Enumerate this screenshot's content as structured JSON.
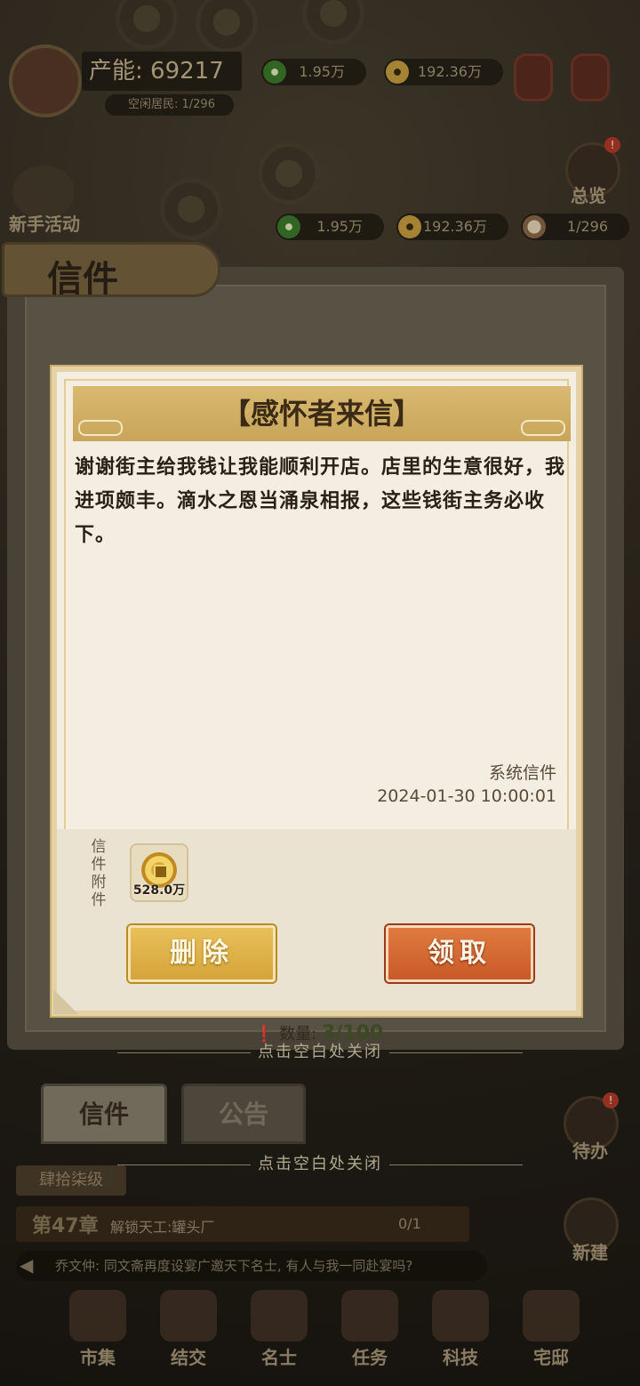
{
  "hud": {
    "production": "产能: 69217",
    "idle_residents": "空闲居民: 1/296",
    "res_green": "1.95万",
    "res_gold": "192.36万"
  },
  "side": {
    "overview_label": "总览",
    "newbie_label": "新手活动"
  },
  "resources": {
    "green": "1.95万",
    "gold": "192.36万",
    "residents": "1/296"
  },
  "mail_panel": {
    "title": "信件",
    "count_label": "数量:",
    "count_value": "3/100",
    "tabs": [
      "信件",
      "公告"
    ],
    "close_hint": "点击空白处关闭"
  },
  "bottom": {
    "todo_label": "待办",
    "build_label": "新建",
    "close_hint": "点击空白处关闭",
    "level_tag": "肆拾柒级",
    "chapter": "第47章",
    "chapter_goal": "解锁天工:罐头厂",
    "chapter_progress": "0/1",
    "chat": "乔文仲: 同文斋再度设宴广邀天下名士, 有人与我一同赴宴吗?",
    "nav": [
      "市集",
      "结交",
      "名士",
      "任务",
      "科技",
      "宅邸"
    ]
  },
  "letter": {
    "title": "【感怀者来信】",
    "body": "谢谢街主给我钱让我能顺利开店。店里的生意很好，我进项颇丰。滴水之恩当涌泉相报，这些钱街主务必收下。",
    "sender": "系统信件",
    "time": "2024-01-30  10:00:01",
    "attachment_label": "信件附件",
    "attachment_qty": "528.0万",
    "attachment_icon": "copper-coin-icon",
    "delete_label": "删除",
    "claim_label": "领取"
  },
  "colors": {
    "claim_button": "#c85a28",
    "delete_button": "#d5a43a",
    "paper": "#f3eee1"
  }
}
